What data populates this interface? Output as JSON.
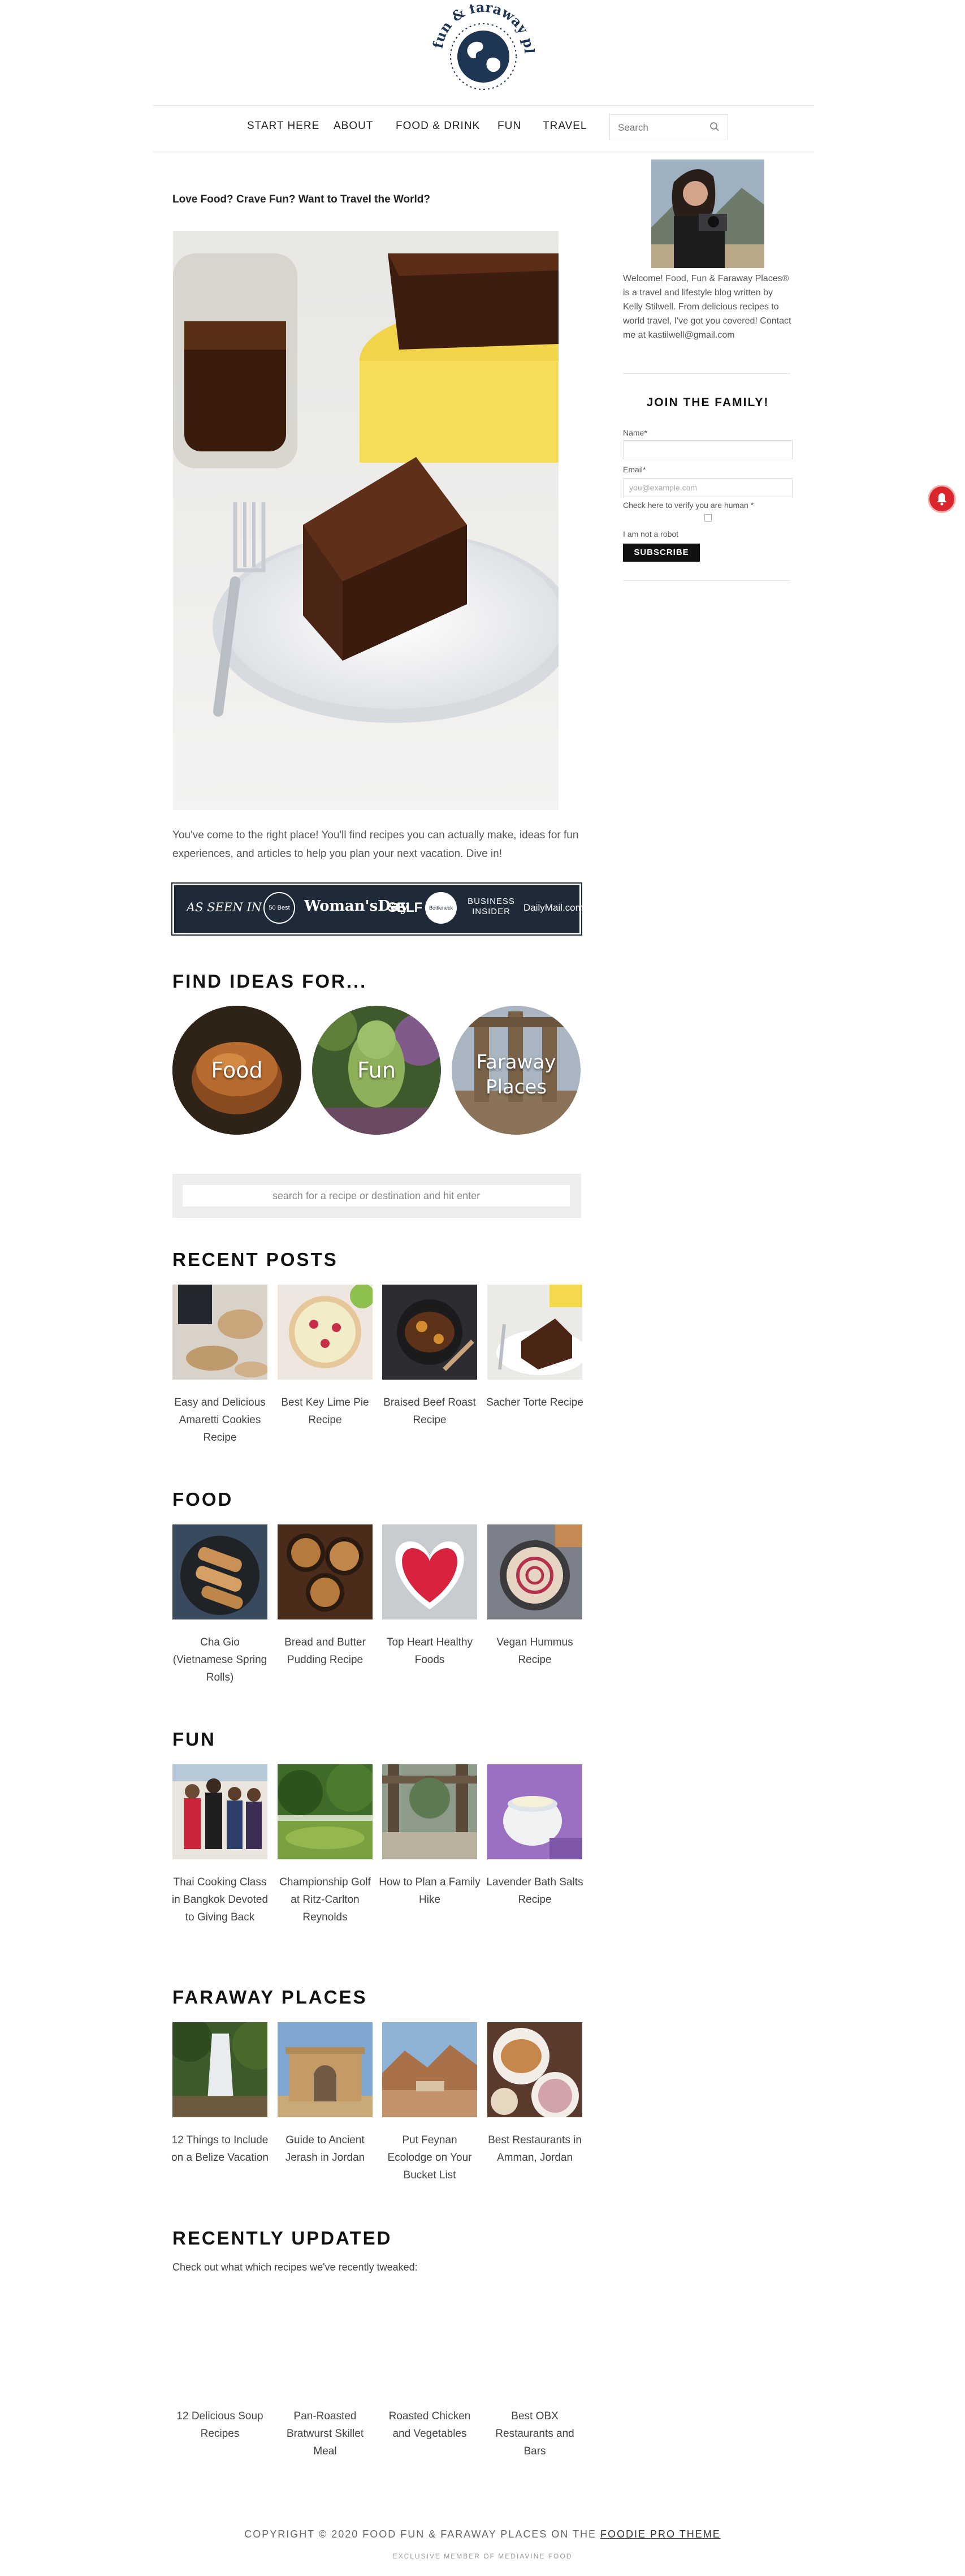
{
  "header": {
    "logo_text": "food fun & faraway places",
    "nav": [
      "Start Here",
      "About",
      "Food & Drink",
      "Fun",
      "Travel"
    ],
    "search_placeholder": "Search"
  },
  "main": {
    "intro_heading": "Love Food? Crave Fun? Want to Travel the World?",
    "intro_text": "You've come to the right place! You'll find recipes you can actually make, ideas for fun experiences, and articles to help you plan your next vacation. Dive in!",
    "as_seen_in": {
      "label": "AS SEEN IN",
      "outlets": [
        "50 Best",
        "Woman'sDay",
        "SELF",
        "Bottleneck",
        "BUSINESS INSIDER",
        "DailyMail.com"
      ]
    },
    "find_ideas": {
      "title": "Find Ideas For...",
      "circles": [
        "Food",
        "Fun",
        "Faraway Places"
      ]
    },
    "search_placeholder": "search for a recipe  or destination and hit enter",
    "recent_posts": {
      "title": "Recent Posts",
      "items": [
        "Easy and Delicious Amaretti Cookies Recipe",
        "Best Key Lime Pie Recipe",
        "Braised Beef Roast Recipe",
        "Sacher Torte Recipe"
      ]
    },
    "food": {
      "title": "Food",
      "items": [
        "Cha Gio (Vietnamese Spring Rolls)",
        "Bread and Butter Pudding Recipe",
        "Top Heart Healthy Foods",
        "Vegan Hummus Recipe"
      ]
    },
    "fun": {
      "title": "Fun",
      "items": [
        "Thai Cooking Class in Bangkok Devoted to Giving Back",
        "Championship Golf at Ritz-Carlton Reynolds",
        "How to Plan a Family Hike",
        "Lavender Bath Salts Recipe"
      ]
    },
    "faraway": {
      "title": "Faraway Places",
      "items": [
        "12 Things to Include on a Belize Vacation",
        "Guide to Ancient Jerash in Jordan",
        "Put Feynan Ecolodge on Your Bucket List",
        "Best Restaurants in Amman, Jordan"
      ]
    },
    "recently_updated": {
      "title": "Recently Updated",
      "text": "Check out what which recipes we've recently tweaked:",
      "items": [
        "12 Delicious Soup Recipes",
        "Pan-Roasted Bratwurst Skillet Meal",
        "Roasted Chicken and Vegetables",
        "Best OBX Restaurants and Bars"
      ]
    }
  },
  "sidebar": {
    "bio": "Welcome! Food, Fun & Faraway Places® is a travel and lifestyle blog written by Kelly Stilwell. From delicious recipes to world travel, I've got you covered! Contact me at kastilwell@gmail.com",
    "join_title": "JOIN THE FAMILY!",
    "name_label": "Name*",
    "email_label": "Email*",
    "email_placeholder": "you@example.com",
    "human_label": "Check here to verify you are human *",
    "robot_label": "I am not a robot",
    "subscribe_label": "SUBSCRIBE"
  },
  "footer": {
    "copyright_prefix": "COPYRIGHT © 2020 FOOD FUN & FARAWAY PLACES ON THE ",
    "theme_link": "FOODIE PRO THEME",
    "member": "EXCLUSIVE MEMBER OF MEDIAVINE FOOD"
  },
  "colors": {
    "banner_bg": "#1e2a38",
    "button_bg": "#111111",
    "notification": "#d9262c"
  }
}
